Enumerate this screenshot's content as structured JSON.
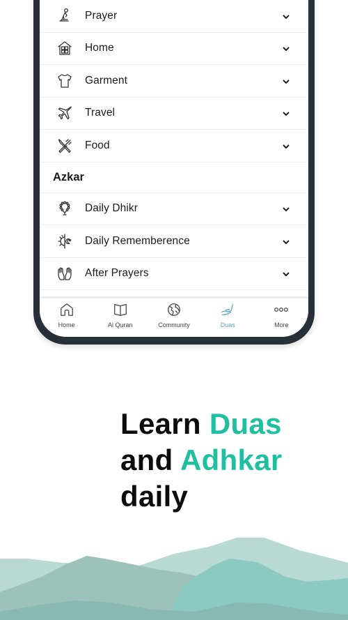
{
  "duas_list": {
    "items": [
      {
        "label": "Prayer",
        "icon": "praying-person-icon"
      },
      {
        "label": "Home",
        "icon": "house-icon"
      },
      {
        "label": "Garment",
        "icon": "tshirt-icon"
      },
      {
        "label": "Travel",
        "icon": "airplane-icon"
      },
      {
        "label": "Food",
        "icon": "fork-knife-icon"
      }
    ],
    "section_title": "Azkar",
    "azkar_items": [
      {
        "label": "Daily Dhikr",
        "icon": "prayer-beads-icon"
      },
      {
        "label": "Daily Rememberence",
        "icon": "sun-moon-icon"
      },
      {
        "label": "After Prayers",
        "icon": "raised-hands-icon"
      }
    ]
  },
  "bottom_nav": {
    "items": [
      {
        "label": "Home",
        "icon": "home-icon",
        "active": false
      },
      {
        "label": "Al Quran",
        "icon": "open-book-icon",
        "active": false
      },
      {
        "label": "Community",
        "icon": "globe-icon",
        "active": false
      },
      {
        "label": "Duas",
        "icon": "dua-hand-icon",
        "active": true
      },
      {
        "label": "More",
        "icon": "more-dots-icon",
        "active": false
      }
    ],
    "active_color": "#5aa7c2"
  },
  "headline": {
    "line1_plain": "Learn ",
    "line1_accent": "Duas",
    "line2_plain": "and ",
    "line2_accent": "Adhkar",
    "line3_plain": "daily",
    "accent_color": "#1fbf9f"
  }
}
